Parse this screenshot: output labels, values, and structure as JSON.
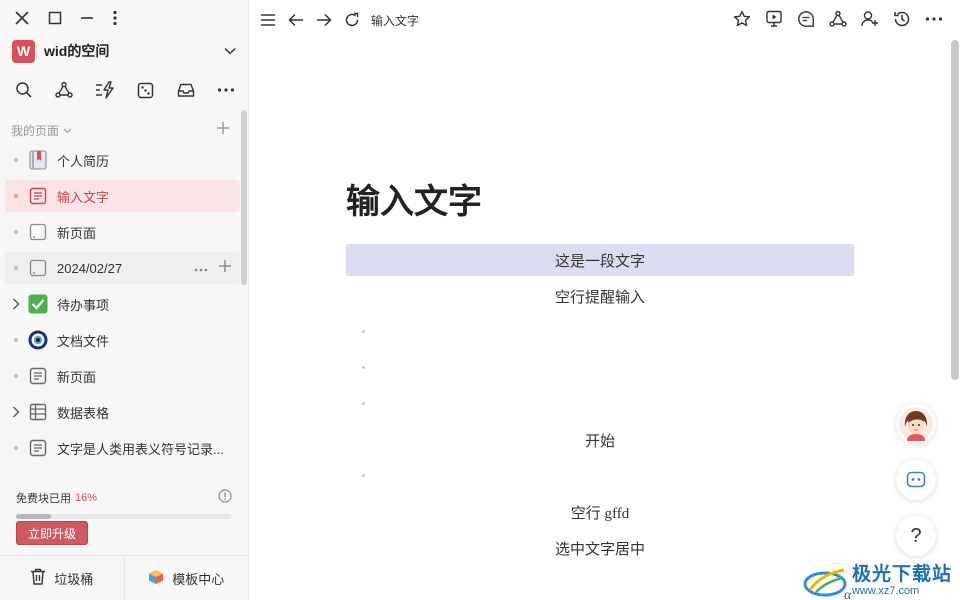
{
  "sidebar": {
    "space": {
      "logo_letter": "W",
      "name": "wid的空间",
      "logo_color": "#d9505a"
    },
    "section_label": "我的页面",
    "pages": [
      {
        "label": "个人简历",
        "icon": "bookmark-book-icon",
        "expandable": false
      },
      {
        "label": "输入文字",
        "icon": "doc-icon",
        "expandable": false,
        "active": true
      },
      {
        "label": "新页面",
        "icon": "blank-page-icon",
        "expandable": false
      },
      {
        "label": "2024/02/27",
        "icon": "blank-page-icon",
        "expandable": false,
        "hover": true
      },
      {
        "label": "待办事项",
        "icon": "checkbox-icon",
        "expandable": true
      },
      {
        "label": "文档文件",
        "icon": "eye-charm-icon",
        "expandable": false
      },
      {
        "label": "新页面",
        "icon": "doc-icon",
        "expandable": false
      },
      {
        "label": "数据表格",
        "icon": "table-icon",
        "expandable": true
      },
      {
        "label": "文字是人类用表义符号记录...",
        "icon": "doc-icon",
        "expandable": false
      }
    ],
    "usage": {
      "label": "免费块已用",
      "percent_text": "16%",
      "percent": 16
    },
    "upgrade_label": "立即升级",
    "footer": {
      "trash_label": "垃圾桶",
      "templates_label": "模板中心"
    }
  },
  "topbar": {
    "breadcrumb": "输入文字"
  },
  "document": {
    "title": "输入文字",
    "blocks": [
      {
        "text": "这是一段文字",
        "selected": true
      },
      {
        "text": "空行提醒输入"
      },
      {
        "text": ""
      },
      {
        "text": ""
      },
      {
        "text": ""
      },
      {
        "text": "开始"
      },
      {
        "text": ""
      },
      {
        "text": "空行 gffd"
      },
      {
        "text": "选中文字居中"
      }
    ],
    "trailing_glyph": "α"
  },
  "watermark": {
    "line1": "极光下载站",
    "line2": "www.xz7.com"
  },
  "colors": {
    "accent": "#d9505a",
    "selection": "#dcdcf2",
    "active_item_bg": "#f9e3e4",
    "brand_blue": "#1e6fb5"
  }
}
